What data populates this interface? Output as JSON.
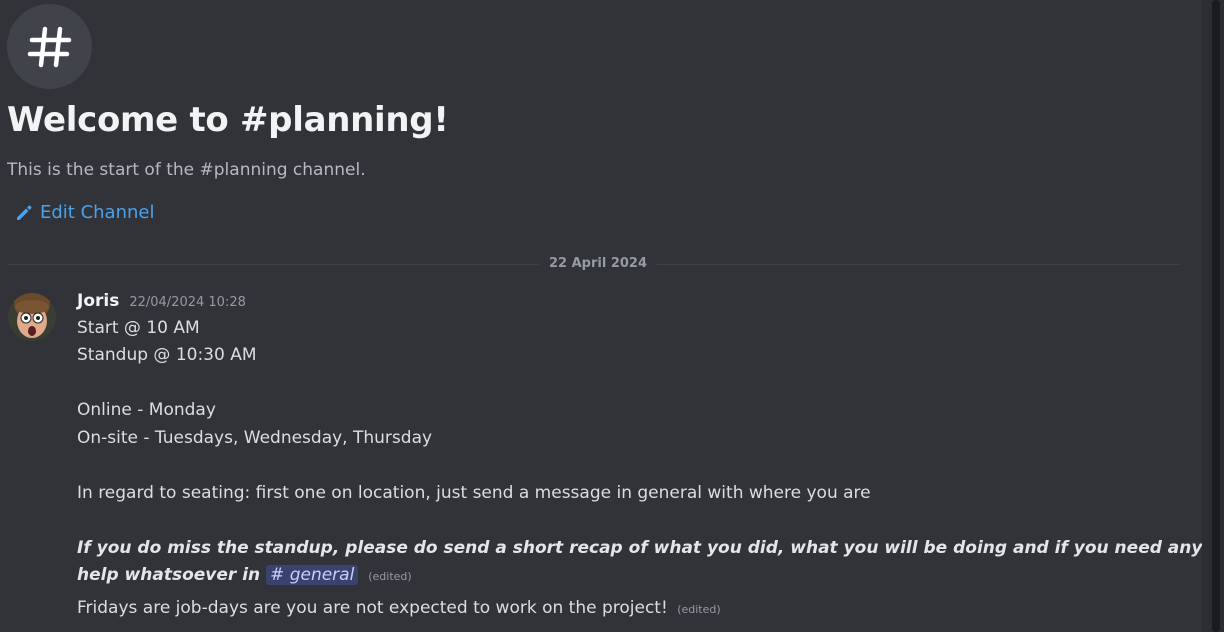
{
  "channel": {
    "icon": "hashtag-icon",
    "welcome_title": "Welcome to #planning!",
    "welcome_subtitle": "This is the start of the #planning channel.",
    "edit_label": "Edit Channel",
    "edit_icon": "pencil-icon"
  },
  "divider": {
    "date": "22 April 2024"
  },
  "message": {
    "author": "Joris",
    "timestamp": "22/04/2024 10:28",
    "lines": {
      "l1": "Start @ 10 AM",
      "l2": "Standup @ 10:30 AM",
      "l3": "Online - Monday",
      "l4": "On-site - Tuesdays, Wednesday, Thursday",
      "l5": "In regard to seating: first one on location, just send a message in general with where you are",
      "l6": "If you do miss the standup, please do send a short recap of what you did, what you will be doing and if you need any",
      "l7_prefix": "help whatsoever in",
      "mention": "general",
      "l8": "Fridays are job-days are you are not expected to work on the project!"
    },
    "edited_label": "(edited)"
  },
  "colors": {
    "background": "#313338",
    "link": "#4aa2ee",
    "mention_bg": "#3c4270"
  }
}
